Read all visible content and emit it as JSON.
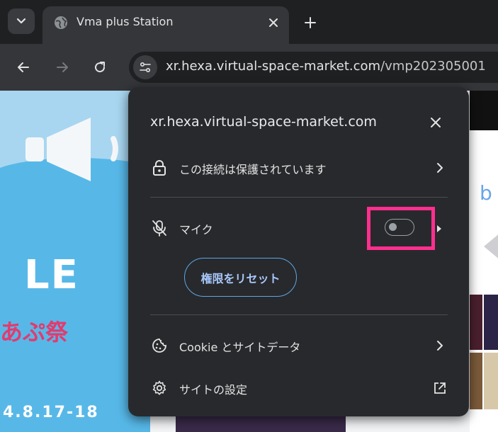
{
  "browser": {
    "tab": {
      "title": "Vma plus Station"
    },
    "url": {
      "host": "xr.hexa.virtual-space-market.com",
      "path": "/vmp202305001"
    }
  },
  "page_content": {
    "big_text": "LE",
    "fest_text": "あぷ祭",
    "date_text": "4.8.17-18",
    "right_letter": "b"
  },
  "popup": {
    "title": "xr.hexa.virtual-space-market.com",
    "connection": {
      "label": "この接続は保護されています"
    },
    "microphone": {
      "label": "マイク",
      "enabled": false
    },
    "reset_button": "権限をリセット",
    "cookies": {
      "label": "Cookie とサイトデータ"
    },
    "site_settings": {
      "label": "サイトの設定"
    }
  },
  "colors": {
    "highlight": "#ff2f8e",
    "accent": "#a8c7fa"
  }
}
